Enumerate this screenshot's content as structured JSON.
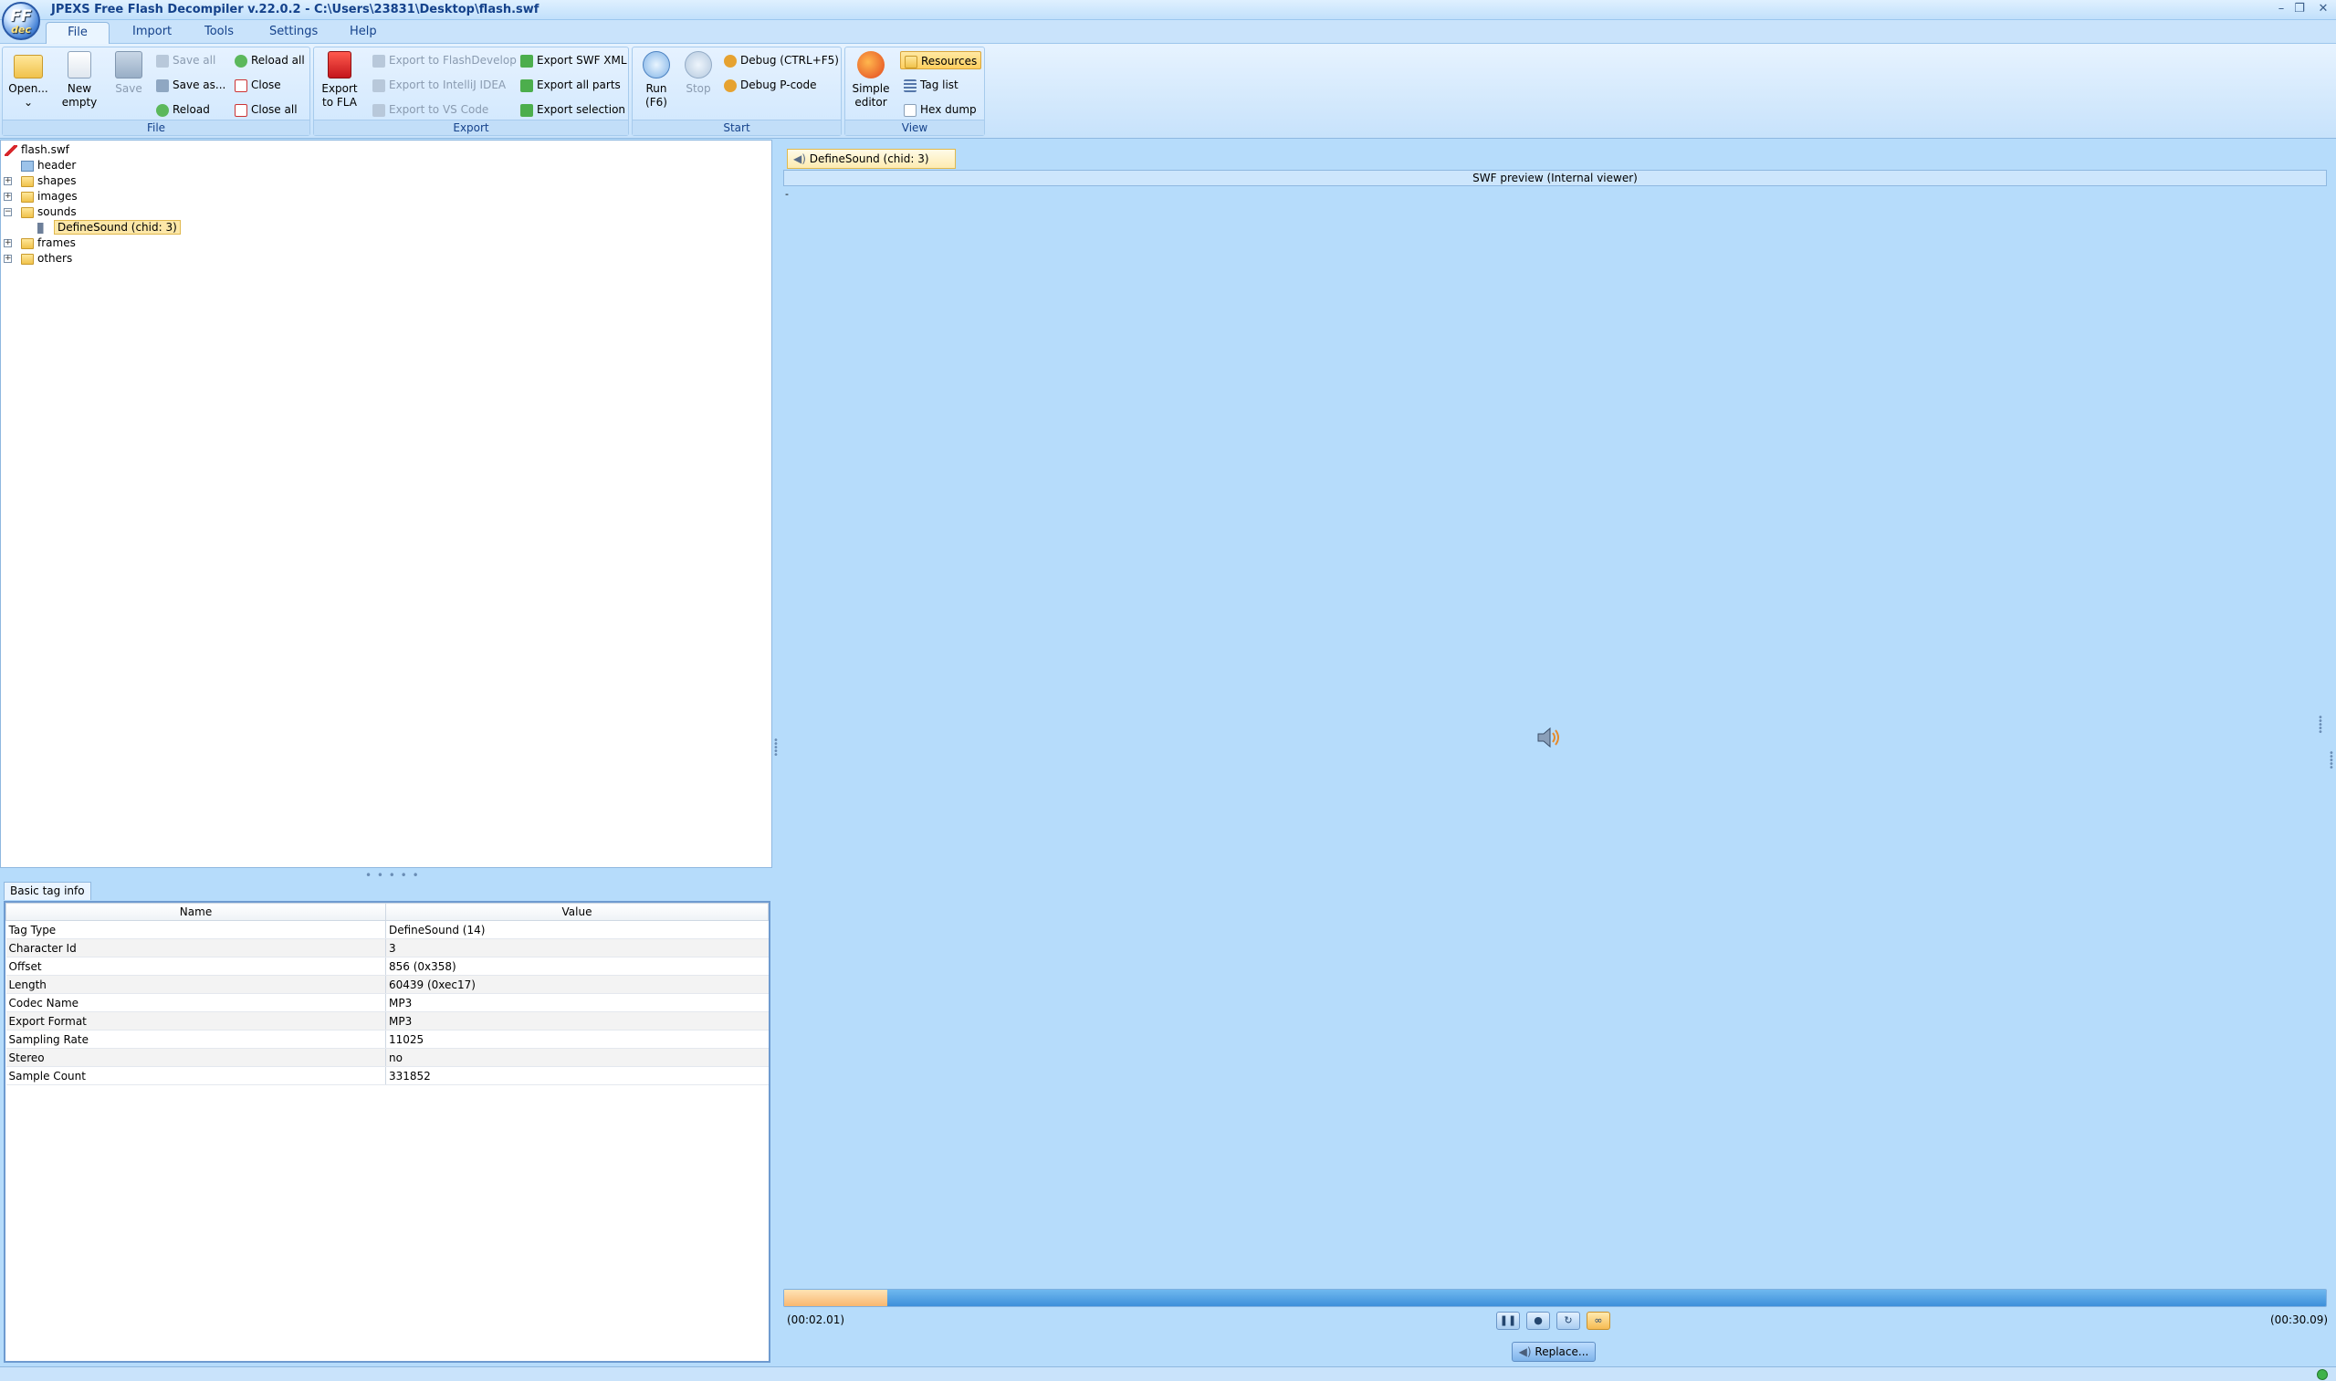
{
  "window": {
    "title": "JPEXS Free Flash Decompiler v.22.0.2 - C:\\Users\\23831\\Desktop\\flash.swf",
    "logo_text_top": "FF",
    "logo_text_bottom": "dec",
    "controls": [
      "–",
      "❐",
      "✕"
    ]
  },
  "menu": {
    "items": [
      "File",
      "Import",
      "Tools",
      "Settings",
      "Help"
    ]
  },
  "ribbon": {
    "file": {
      "label": "File",
      "open": "Open...",
      "open_arrow": "⌄",
      "new_line1": "New",
      "new_line2": "empty",
      "save": "Save",
      "save_all": "Save all",
      "save_as": "Save as...",
      "reload": "Reload",
      "reload_all": "Reload all",
      "close": "Close",
      "close_all": "Close all"
    },
    "export": {
      "label": "Export",
      "export_fla_line1": "Export",
      "export_fla_line2": "to FLA",
      "to_flashdevelop": "Export to FlashDevelop",
      "to_intellij": "Export to IntelliJ IDEA",
      "to_vscode": "Export to VS Code",
      "swf_xml": "Export SWF XML",
      "all_parts": "Export all parts",
      "selection": "Export selection"
    },
    "start": {
      "label": "Start",
      "run_line1": "Run",
      "run_line2": "(F6)",
      "stop": "Stop",
      "debug": "Debug (CTRL+F5)",
      "debug_pcode": "Debug P-code"
    },
    "view": {
      "label": "View",
      "simple_line1": "Simple",
      "simple_line2": "editor",
      "resources": "Resources",
      "tag_list": "Tag list",
      "hex_dump": "Hex dump"
    }
  },
  "tree": {
    "root": "flash.swf",
    "items": [
      "header",
      "shapes",
      "images",
      "sounds",
      "frames",
      "others"
    ],
    "selected": "DefineSound (chid: 3)",
    "toggle_plus": "+",
    "toggle_minus": "−"
  },
  "tag_info": {
    "tab": "Basic tag info",
    "headers": [
      "Name",
      "Value"
    ],
    "rows": [
      [
        "Tag Type",
        "DefineSound (14)"
      ],
      [
        "Character Id",
        "3"
      ],
      [
        "Offset",
        "856 (0x358)"
      ],
      [
        "Length",
        "60439 (0xec17)"
      ],
      [
        "Codec Name",
        "MP3"
      ],
      [
        "Export Format",
        "MP3"
      ],
      [
        "Sampling Rate",
        "11025"
      ],
      [
        "Stereo",
        "no"
      ],
      [
        "Sample Count",
        "331852"
      ]
    ]
  },
  "preview": {
    "tab": "DefineSound (chid: 3)",
    "header": "SWF preview (Internal viewer)",
    "dash": "-",
    "speaker_icon": "speaker-icon",
    "player": {
      "time_current": "(00:02.01)",
      "time_total": "(00:30.09)",
      "progress": 0.067,
      "buttons": [
        "❚❚",
        "●",
        "↻",
        "∞"
      ],
      "replace": "Replace..."
    }
  },
  "colors": {
    "accent": "#15428b",
    "background": "#b6dcfb",
    "selection": "#fce7a8"
  }
}
